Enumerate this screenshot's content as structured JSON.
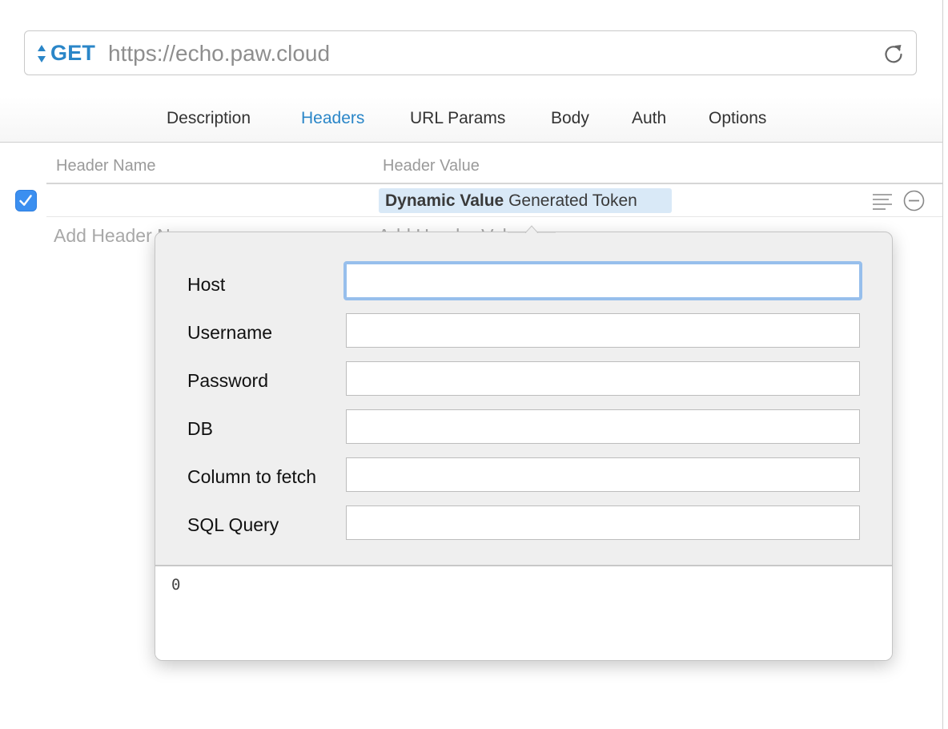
{
  "request": {
    "method": "GET",
    "url": "https://echo.paw.cloud"
  },
  "tabs": [
    {
      "label": "Description",
      "active": false
    },
    {
      "label": "Headers",
      "active": true
    },
    {
      "label": "URL Params",
      "active": false
    },
    {
      "label": "Body",
      "active": false
    },
    {
      "label": "Auth",
      "active": false
    },
    {
      "label": "Options",
      "active": false
    }
  ],
  "headers_table": {
    "col_name": "Header Name",
    "col_value": "Header Value",
    "row": {
      "enabled": true,
      "name": "",
      "value_type": "Dynamic Value",
      "value_name": "Generated Token"
    },
    "add_name_placeholder": "Add Header Name",
    "add_value_placeholder": "Add Header Value"
  },
  "popover": {
    "fields": [
      {
        "label": "Host",
        "value": ""
      },
      {
        "label": "Username",
        "value": ""
      },
      {
        "label": "Password",
        "value": ""
      },
      {
        "label": "DB",
        "value": ""
      },
      {
        "label": "Column to fetch",
        "value": ""
      },
      {
        "label": "SQL Query",
        "value": ""
      }
    ],
    "preview": "0"
  },
  "colors": {
    "accent": "#2a86c8",
    "checkbox": "#3b8ff0",
    "token_bg": "#d9e9f7",
    "focus_ring": "#97bfec"
  },
  "icons": [
    "up-down-arrows-icon",
    "reload-icon",
    "checkmark-icon",
    "lines-icon",
    "minus-circle-icon"
  ]
}
